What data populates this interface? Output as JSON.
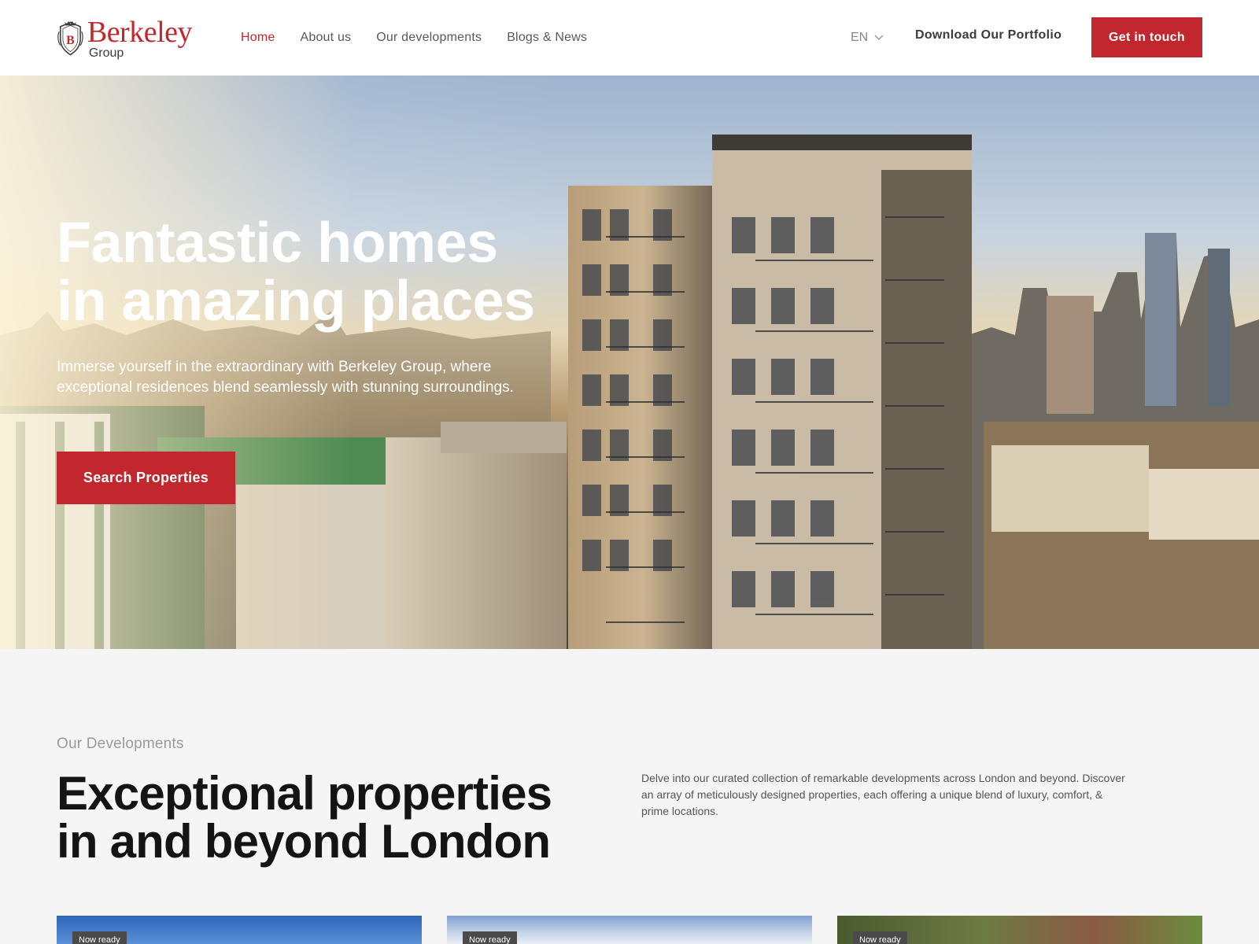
{
  "brand": {
    "name": "Berkeley",
    "sub": "Group",
    "color": "#c1272d"
  },
  "nav": {
    "items": [
      {
        "label": "Home",
        "active": true
      },
      {
        "label": "About us",
        "active": false
      },
      {
        "label": "Our developments",
        "active": false
      },
      {
        "label": "Blogs & News",
        "active": false
      }
    ]
  },
  "header": {
    "language": "EN",
    "portfolio_label": "Download Our Portfolio",
    "cta_label": "Get in touch"
  },
  "hero": {
    "title_line1": "Fantastic homes",
    "title_line2": "in amazing places",
    "description": "Immerse yourself in the extraordinary with Berkeley Group, where exceptional residences blend seamlessly with stunning surroundings.",
    "search_label": "Search Properties"
  },
  "developments": {
    "eyebrow": "Our Developments",
    "title_line1": "Exceptional properties",
    "title_line2": "in and beyond London",
    "description": "Delve into our curated collection of remarkable developments across London and beyond. Discover an array of meticulously designed properties, each offering a unique blend of luxury, comfort, & prime locations.",
    "cards": [
      {
        "badge": "Now ready"
      },
      {
        "badge": "Now ready"
      },
      {
        "badge": "Now ready"
      }
    ]
  },
  "icons": {
    "logo": "berkeley-crest-icon",
    "language_toggle": "chevron-down-icon"
  }
}
